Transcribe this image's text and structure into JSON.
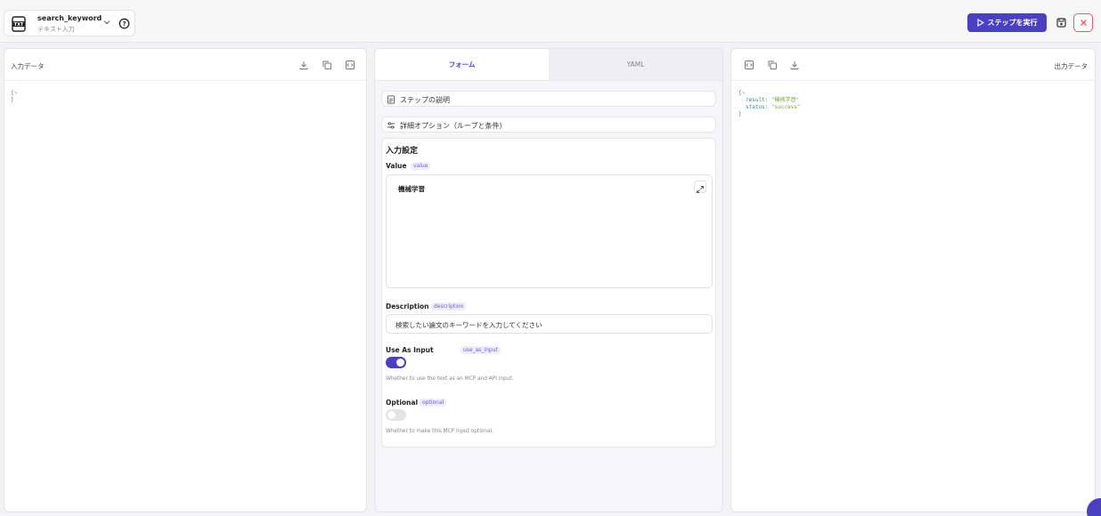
{
  "header": {
    "step_name": "search_keyword",
    "step_type": "テキスト入力",
    "run_label": "ステップを実行"
  },
  "input_panel": {
    "title": "入力データ",
    "code": [
      "{~",
      "}"
    ]
  },
  "middle_panel": {
    "tabs": [
      {
        "label": "フォーム",
        "active": true
      },
      {
        "label": "YAML",
        "active": false
      }
    ],
    "step_description_label": "ステップの説明",
    "advanced_options_label": "詳細オプション（ループと条件）",
    "section_title": "入力設定",
    "fields": {
      "value": {
        "label": "Value",
        "key": "value",
        "content": "機械学習"
      },
      "description": {
        "label": "Description",
        "key": "description",
        "content": "検索したい論文のキーワードを入力してください"
      },
      "use_as_input": {
        "label": "Use As Input",
        "key": "use_as_input",
        "enabled": true,
        "help": "Whether to use the text as an MCP and API input."
      },
      "optional": {
        "label": "Optional",
        "key": "optional",
        "enabled": false,
        "help": "Whether to make this MCP input optional."
      }
    }
  },
  "output_panel": {
    "title": "出力データ",
    "code": {
      "open": "{~",
      "result_key": "result: ",
      "result_val": "\"機械学習\"",
      "status_key": "status: ",
      "status_val": "\"success\"",
      "close": "}"
    }
  },
  "colors": {
    "accent": "#4b3fc4",
    "close_border": "#e35d6a",
    "code_string": "#7aa33a",
    "code_key": "#2f8f86"
  }
}
